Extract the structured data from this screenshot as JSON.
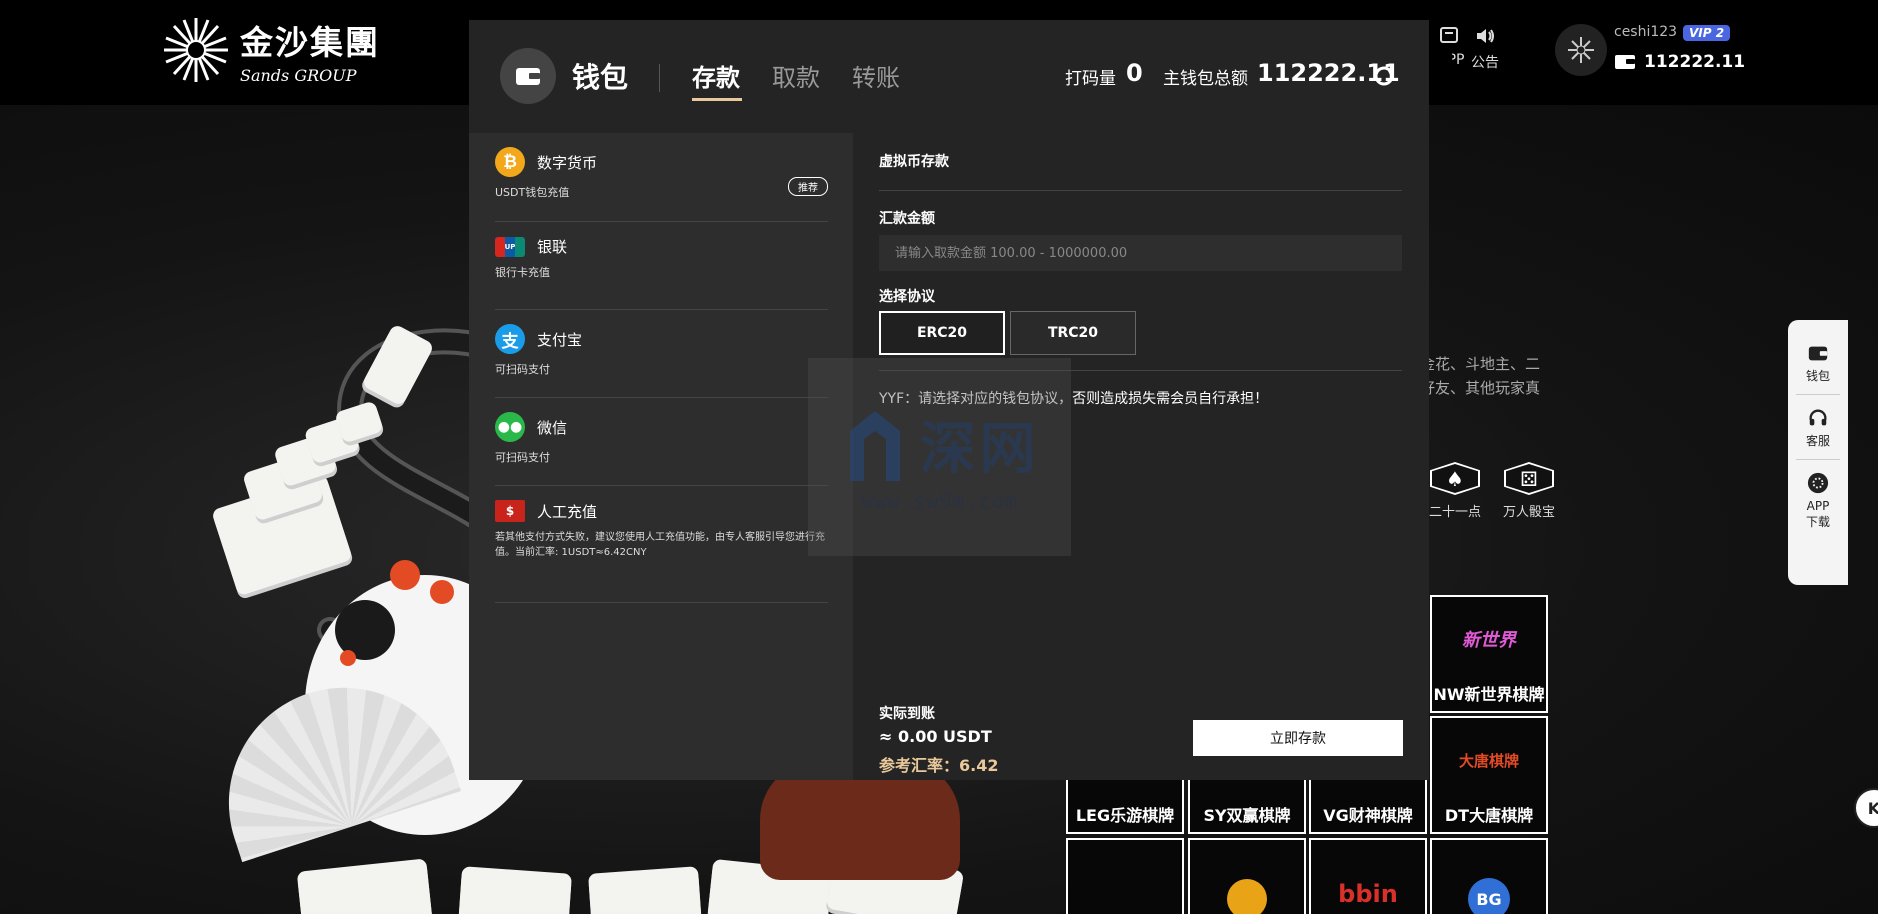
{
  "brand": {
    "name_cn": "金沙集團",
    "name_en": "Sands GROUP"
  },
  "nav": {
    "app_label": "APP",
    "announce_label": "公告"
  },
  "user": {
    "name": "ceshi123",
    "vip": "VIP 2",
    "balance": "112222.11"
  },
  "modal": {
    "title": "钱包",
    "tabs": [
      "存款",
      "取款",
      "转账"
    ],
    "active_tab": "存款",
    "bet_label": "打码量",
    "bet_value": "0",
    "total_label": "主钱包总额",
    "total_value": "112222.11",
    "methods": [
      {
        "name": "数字货币",
        "desc": "USDT钱包充值",
        "badge": "推荐"
      },
      {
        "name": "银联",
        "desc": "银行卡充值"
      },
      {
        "name": "支付宝",
        "desc": "可扫码支付"
      },
      {
        "name": "微信",
        "desc": "可扫码支付"
      },
      {
        "name": "人工充值",
        "desc": "若其他支付方式失败，建议您使用人工充值功能，由专人客服引导您进行充值。当前汇率: 1USDT≈6.42CNY"
      }
    ],
    "form": {
      "section_title": "虚拟币存款",
      "amount_label": "汇款金额",
      "amount_placeholder": "请输入取款金额 100.00 - 1000000.00",
      "protocol_label": "选择协议",
      "protocols": [
        "ERC20",
        "TRC20"
      ],
      "selected_protocol": "ERC20",
      "notice": "YYF：请选择对应的钱包协议，否则造成损失需会员自行承担！",
      "actual_label": "实际到账",
      "actual_value": "≈ 0.00 USDT",
      "rate_label": "参考汇率：6.42",
      "deposit_button": "立即存款"
    }
  },
  "background": {
    "desc_line1": "金花、斗地主、二",
    "desc_line2": "好友、其他玩家真",
    "hex_games": [
      "二十一点",
      "万人骰宝"
    ],
    "game_tiles": [
      {
        "name": "NW新世界棋牌",
        "logo": "新世界"
      },
      {
        "name": "LEG乐游棋牌",
        "logo": ""
      },
      {
        "name": "SY双赢棋牌",
        "logo": ""
      },
      {
        "name": "VG财神棋牌",
        "logo": ""
      },
      {
        "name": "DT大唐棋牌",
        "logo": "大唐棋牌"
      },
      {
        "name": "",
        "logo": "KX"
      },
      {
        "name": "",
        "logo": ""
      },
      {
        "name": "",
        "logo": "bbin"
      },
      {
        "name": "",
        "logo": "BG"
      }
    ]
  },
  "sidebar": {
    "items": [
      "钱包",
      "客服",
      "APP下载"
    ]
  },
  "watermark": {
    "cn": "深网",
    "url": "www.sw9m.com"
  },
  "colors": {
    "accent_gold": "#e9c89b",
    "vip_blue": "#4a66e0",
    "modal_bg": "#2b2b2b"
  }
}
